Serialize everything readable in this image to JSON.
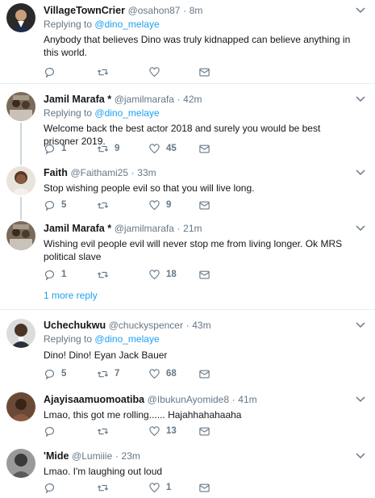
{
  "colors": {
    "link": "#1da1f2",
    "muted": "#657786",
    "text": "#14171a",
    "divider": "#e6ecf0",
    "thread_line": "#ccd6dd"
  },
  "icons": {
    "reply": "reply-icon",
    "retweet": "retweet-icon",
    "like": "heart-icon",
    "dm": "envelope-icon",
    "more": "chevron-down-icon"
  },
  "reply_prefix": "Replying to",
  "more_replies": "1 more reply",
  "tweets": [
    {
      "name": "VillageTownCrier",
      "handle": "@osahon87",
      "dot": "·",
      "time": "8m",
      "replying_to": "@dino_melaye",
      "text": "Anybody that believes Dino was truly kidnapped can believe anything in this world.",
      "replies": "",
      "retweets": "",
      "likes": ""
    },
    {
      "name": "Jamil Marafa *",
      "handle": "@jamilmarafa",
      "dot": "·",
      "time": "42m",
      "replying_to": "@dino_melaye",
      "text": "Welcome back the best actor 2018 and surely you would be best prisoner 2019.",
      "replies": "1",
      "retweets": "9",
      "likes": "45"
    },
    {
      "name": "Faith",
      "handle": "@Faithami25",
      "dot": "·",
      "time": "33m",
      "replying_to": "",
      "text": "Stop wishing people evil so that you will live long.",
      "replies": "5",
      "retweets": "",
      "likes": "9"
    },
    {
      "name": "Jamil Marafa *",
      "handle": "@jamilmarafa",
      "dot": "·",
      "time": "21m",
      "replying_to": "",
      "text": "Wishing evil people evil will never stop me from living longer. Ok MRS political slave",
      "replies": "1",
      "retweets": "",
      "likes": "18"
    },
    {
      "name": "Uchechukwu",
      "handle": "@chuckyspencer",
      "dot": "·",
      "time": "43m",
      "replying_to": "@dino_melaye",
      "text": "Dino!  Dino! Eyan Jack Bauer",
      "replies": "5",
      "retweets": "7",
      "likes": "68"
    },
    {
      "name": "Ajayisaamuomoatiba",
      "handle": "@IbukunAyomide8",
      "dot": "·",
      "time": "41m",
      "replying_to": "",
      "text": "Lmao, this got me rolling...... Hajahhahahaaha",
      "replies": "",
      "retweets": "",
      "likes": "13"
    },
    {
      "name": "'Mide",
      "handle": "@Lumiiie",
      "dot": "·",
      "time": "23m",
      "replying_to": "",
      "text": "Lmao. I'm laughing out loud",
      "replies": "",
      "retweets": "",
      "likes": "1"
    }
  ]
}
